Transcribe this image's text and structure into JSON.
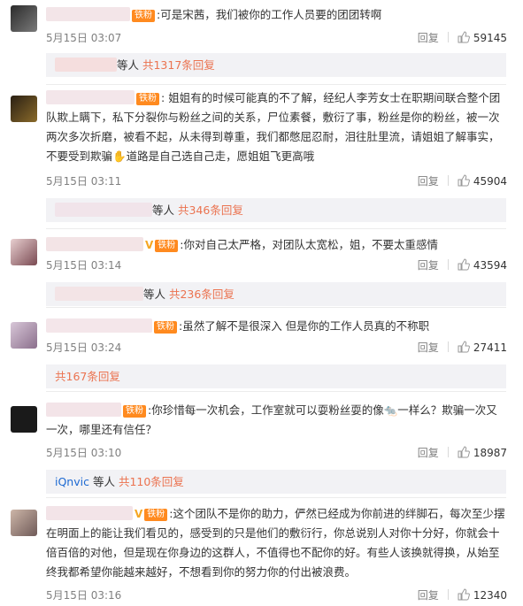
{
  "comments": [
    {
      "text": ":可是宋茜，我们被你的工作人员要的团团转啊",
      "time": "5月15日 03:07",
      "reply_label": "回复",
      "likes": "59145",
      "fan_badge": "铁粉",
      "reply_summary": {
        "suffix": "等人 ",
        "more": "共1317条回复"
      }
    },
    {
      "text": "姐姐有的时候可能真的不了解，经纪人李芳女士在职期间联合整个团队欺上瞒下，私下分裂你与粉丝之间的关系，尸位素餐，敷衍了事，粉丝是你的粉丝，被一次两次多次折磨，被看不起，从未得到尊重，我们都憋屈忍耐，泪往肚里流，请姐姐了解事实，不要受到欺骗✋道路是自己选自己走，愿姐姐飞更高哦",
      "time": "5月15日 03:11",
      "reply_label": "回复",
      "likes": "45904",
      "fan_badge": "铁粉",
      "reply_summary": {
        "suffix": "等人 ",
        "more": "共346条回复"
      }
    },
    {
      "text": ":你对自己太严格，对团队太宽松，姐，不要太重感情",
      "time": "5月15日 03:14",
      "reply_label": "回复",
      "likes": "43594",
      "fan_badge": "铁粉",
      "reply_summary": {
        "suffix": "等人 ",
        "more": "共236条回复"
      }
    },
    {
      "text": ":虽然了解不是很深入 但是你的工作人员真的不称职",
      "time": "5月15日 03:24",
      "reply_label": "回复",
      "likes": "27411",
      "fan_badge": "铁粉",
      "reply_summary": {
        "suffix": "",
        "more": "共167条回复"
      }
    },
    {
      "text": ":你珍惜每一次机会，工作室就可以耍粉丝耍的像🐀一样么？欺骗一次又一次，哪里还有信任？",
      "time": "5月15日 03:10",
      "reply_label": "回复",
      "likes": "18987",
      "fan_badge": "铁粉",
      "reply_summary": {
        "name": "iQnvic",
        "suffix": " 等人 ",
        "more": "共110条回复"
      }
    },
    {
      "text": ":这个团队不是你的助力，俨然已经成为你前进的绊脚石，每次至少摆在明面上的能让我们看见的，感受到的只是他们的敷衍行，你总说别人对你十分好，你就会十倍百倍的对他，但是现在你身边的这群人，不值得也不配你的好。有些人该换就得换，从始至终我都希望你能越来越好，不想看到你的努力你的付出被浪费。",
      "time": "5月15日 03:16",
      "reply_label": "回复",
      "likes": "12340",
      "fan_badge": "铁粉"
    }
  ],
  "colors": {
    "link": "#eb7350",
    "blue": "#1e6ad2",
    "badge": "#ff8a1f",
    "reply_bg": "#f2f2f5"
  },
  "icons": {
    "like": "thumbs-up-icon",
    "vip": "v-badge-icon"
  }
}
